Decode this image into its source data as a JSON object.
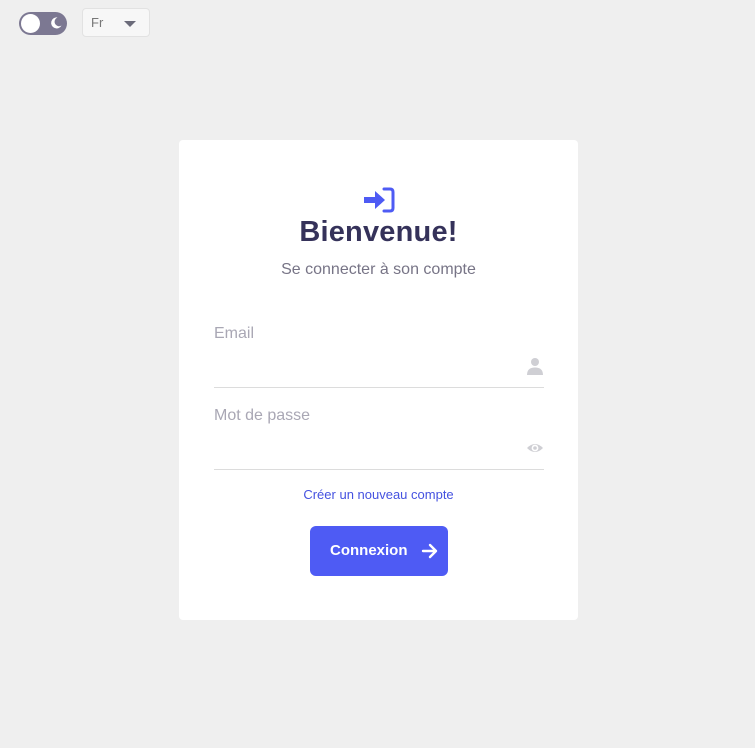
{
  "header": {
    "theme_toggle": {
      "icon": "moon-icon",
      "state": "light"
    },
    "language": {
      "selected": "Fr",
      "icon": "caret-down-icon"
    }
  },
  "card": {
    "icon": "login-icon",
    "title": "Bienvenue!",
    "subtitle": "Se connecter à son compte",
    "email": {
      "label": "Email",
      "value": "",
      "icon": "user-icon"
    },
    "password": {
      "label": "Mot de passe",
      "value": "",
      "icon": "eye-icon"
    },
    "create_account_link": "Créer un nouveau compte",
    "submit": {
      "label": "Connexion",
      "icon": "arrow-right-icon"
    }
  },
  "colors": {
    "background": "#efefef",
    "card": "#ffffff",
    "accent": "#4e5bf4",
    "title": "#35325a",
    "subtitle": "#777486",
    "label": "#a9a7b4",
    "link": "#4552e0",
    "toggle": "#7c7892"
  }
}
